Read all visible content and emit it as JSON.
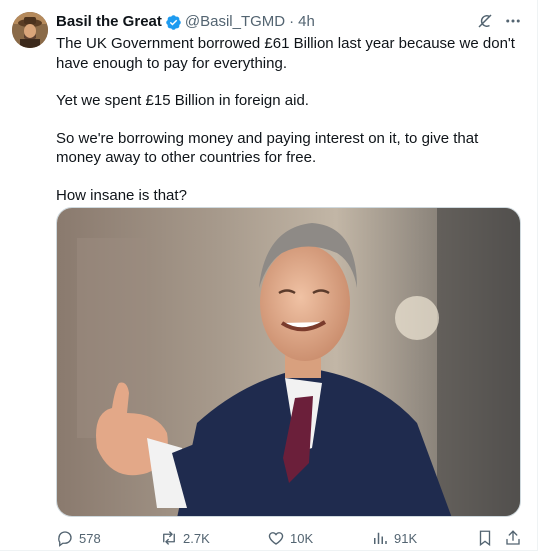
{
  "author": {
    "name": "Basil the Great",
    "handle": "@Basil_TGMD",
    "time": "4h",
    "separator": "·"
  },
  "tweet_text": [
    "The UK Government borrowed £61 Billion last year because we don't have enough to pay for everything.",
    "Yet we spent £15 Billion in foreign aid.",
    "So we're borrowing money and paying interest on it, to give that money away to other countries for free.",
    "How insane is that?"
  ],
  "icons": {
    "verified": "verified-badge-icon",
    "grok": "grok-icon",
    "more": "more-icon",
    "reply": "reply-icon",
    "retweet": "retweet-icon",
    "like": "like-icon",
    "views": "views-icon",
    "bookmark": "bookmark-icon",
    "share": "share-icon"
  },
  "metrics": {
    "replies": "578",
    "retweets": "2.7K",
    "likes": "10K",
    "views": "91K"
  },
  "colors": {
    "verified_blue": "#1d9bf0",
    "text_primary": "#0f1419",
    "text_secondary": "#536471"
  }
}
